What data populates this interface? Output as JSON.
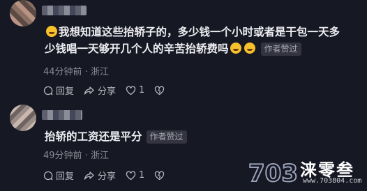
{
  "comments": [
    {
      "text_part1": "我想知道这些抬轿子的，多少钱一个小时或者是干包一天多少钱唱一天够开几个人的辛苦抬轿费吗",
      "line1": "我想知道这些抬轿子的，多少钱一个小时或者是干包一天多",
      "line2": "少钱唱一天够开几个人的辛苦抬轿费吗",
      "badge": "作者赞过",
      "time": "44分钟前",
      "location": "浙江",
      "reply_label": "回复",
      "share_label": "分享",
      "like_count": "1"
    },
    {
      "text": "抬轿的工资还是平分",
      "badge": "作者赞过",
      "time": "49分钟前",
      "location": "浙江",
      "reply_label": "回复",
      "share_label": "分享",
      "like_count": "1"
    }
  ],
  "separator": "·",
  "watermark": {
    "brand": "涞零叁",
    "url": "www.703804.com",
    "logo_text": "703"
  },
  "colors": {
    "background": "#161823",
    "text": "#eeeef2",
    "meta": "#8b8c96",
    "badge_bg": "#33343f"
  }
}
